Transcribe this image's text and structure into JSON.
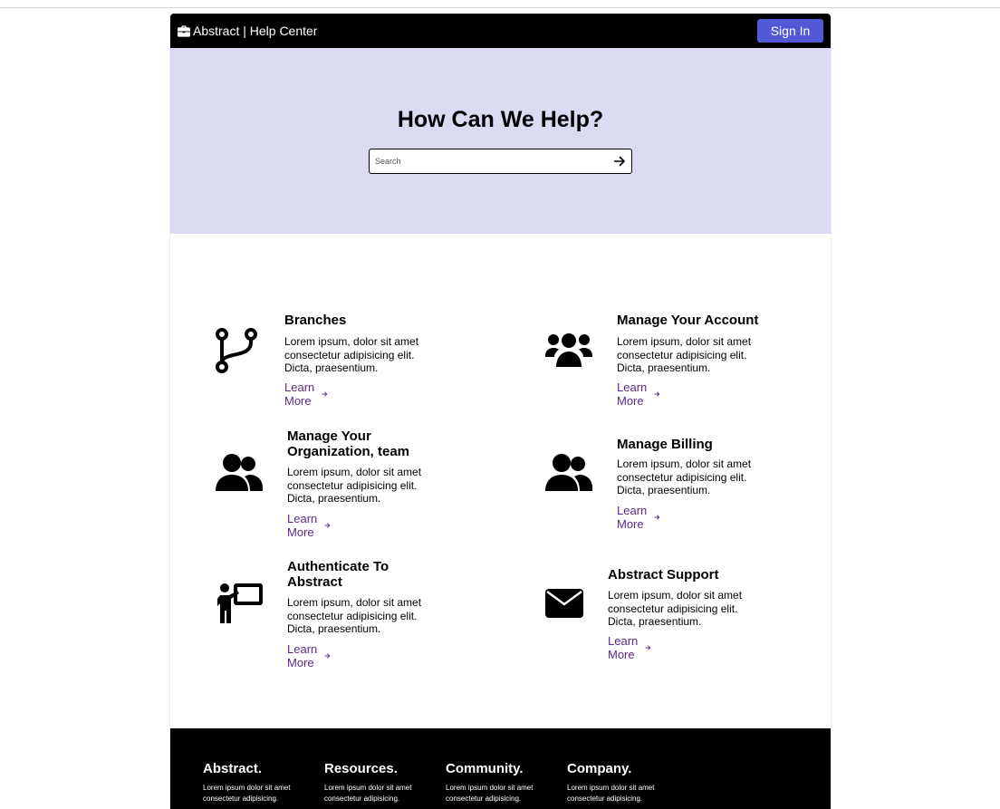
{
  "header": {
    "brand_label": "Abstract | Help Center",
    "brand_icon": "briefcase-icon",
    "signin_label": "Sign In",
    "signin_color": "#5159d6"
  },
  "hero": {
    "title": "How Can We Help?",
    "search_placeholder": "Search",
    "search_value": "",
    "background": "#dadaf2"
  },
  "cards": [
    {
      "icon": "git-branch-icon",
      "title": "Branches",
      "desc": "Lorem ipsum, dolor sit amet consectetur adipisicing elit. Dicta, praesentium.",
      "link": "Learn More"
    },
    {
      "icon": "users-group-icon",
      "title": "Manage Your Account",
      "desc": "Lorem ipsum, dolor sit amet consectetur adipisicing elit. Dicta, praesentium.",
      "link": "Learn More"
    },
    {
      "icon": "user-friends-icon",
      "title": "Manage Your Organization, team",
      "desc": "Lorem ipsum, dolor sit amet consectetur adipisicing elit. Dicta, praesentium.",
      "link": "Learn More"
    },
    {
      "icon": "user-friends-icon",
      "title": "Manage Billing",
      "desc": "Lorem ipsum, dolor sit amet consectetur adipisicing elit. Dicta, praesentium.",
      "link": "Learn More"
    },
    {
      "icon": "presenter-icon",
      "title": "Authenticate To Abstract",
      "desc": "Lorem ipsum, dolor sit amet consectetur adipisicing elit. Dicta, praesentium.",
      "link": "Learn More"
    },
    {
      "icon": "envelope-icon",
      "title": "Abstract Support",
      "desc": "Lorem ipsum, dolor sit amet consectetur adipisicing elit. Dicta, praesentium.",
      "link": "Learn More"
    }
  ],
  "footer": {
    "columns": [
      {
        "title": "Abstract.",
        "text": "Lorem ipsum dolor sit amet consectetur adipisicing."
      },
      {
        "title": "Resources.",
        "text": "Lorem ipsum dolor sit amet consectetur adipisicing."
      },
      {
        "title": "Community.",
        "text": "Lorem ipsum dolor sit amet consectetur adipisicing."
      },
      {
        "title": "Company.",
        "text": "Lorem ipsum dolor sit amet consectetur adipisicing."
      }
    ]
  },
  "colors": {
    "link": "#5b2b86",
    "topbar": "#000000",
    "footer": "#000000"
  }
}
